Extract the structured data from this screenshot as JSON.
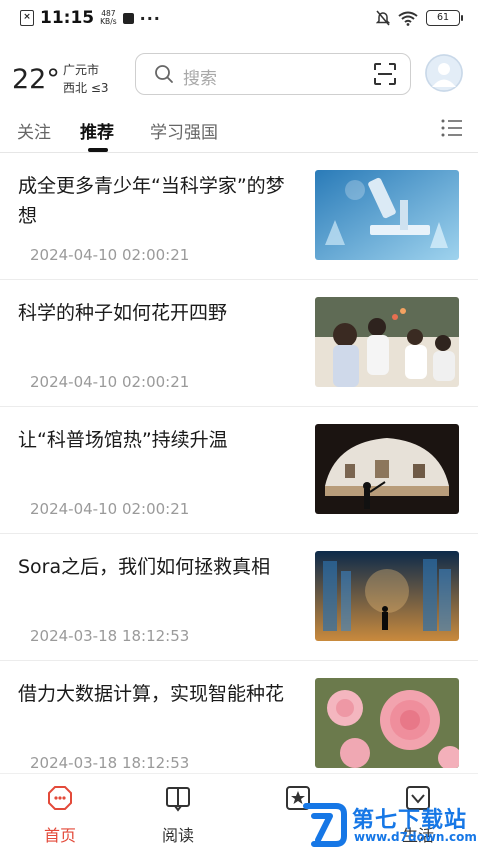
{
  "status_bar": {
    "time": "11:15",
    "net_speed_value": "487",
    "net_speed_unit": "KB/s",
    "more": "···",
    "battery": "61"
  },
  "header": {
    "temperature": "22°",
    "city": "广元市",
    "wind": "西北 ≤3",
    "search_placeholder": "搜索"
  },
  "tabs": [
    {
      "label": "关注",
      "active": false
    },
    {
      "label": "推荐",
      "active": true
    },
    {
      "label": "学习强国",
      "active": false
    }
  ],
  "news": [
    {
      "title": "成全更多青少年“当科学家”的梦想",
      "date": "2024-04-10 02:00:21",
      "thumb": "microscope-lab"
    },
    {
      "title": "科学的种子如何花开四野",
      "date": "2024-04-10 02:00:21",
      "thumb": "classroom-children"
    },
    {
      "title": "让“科普场馆热”持续升温",
      "date": "2024-04-10 02:00:21",
      "thumb": "museum-exhibit"
    },
    {
      "title": "Sora之后，我们如何拯救真相",
      "date": "2024-03-18 18:12:53",
      "thumb": "digital-city"
    },
    {
      "title": "借力大数据计算，实现智能种花",
      "date": "2024-03-18 18:12:53",
      "thumb": "pink-roses"
    }
  ],
  "bottom_nav": [
    {
      "label": "首页",
      "icon": "home-icon",
      "active": true
    },
    {
      "label": "阅读",
      "icon": "book-icon",
      "active": false
    },
    {
      "label": "",
      "icon": "star-icon",
      "active": false
    },
    {
      "label": "生活",
      "icon": "heart-icon",
      "active": false
    }
  ],
  "watermark": {
    "text": "第七下载站",
    "url": "www.d7down.com"
  },
  "colors": {
    "accent": "#e34a3a",
    "watermark": "#1677e6",
    "date_gray": "#9a9a9a"
  }
}
